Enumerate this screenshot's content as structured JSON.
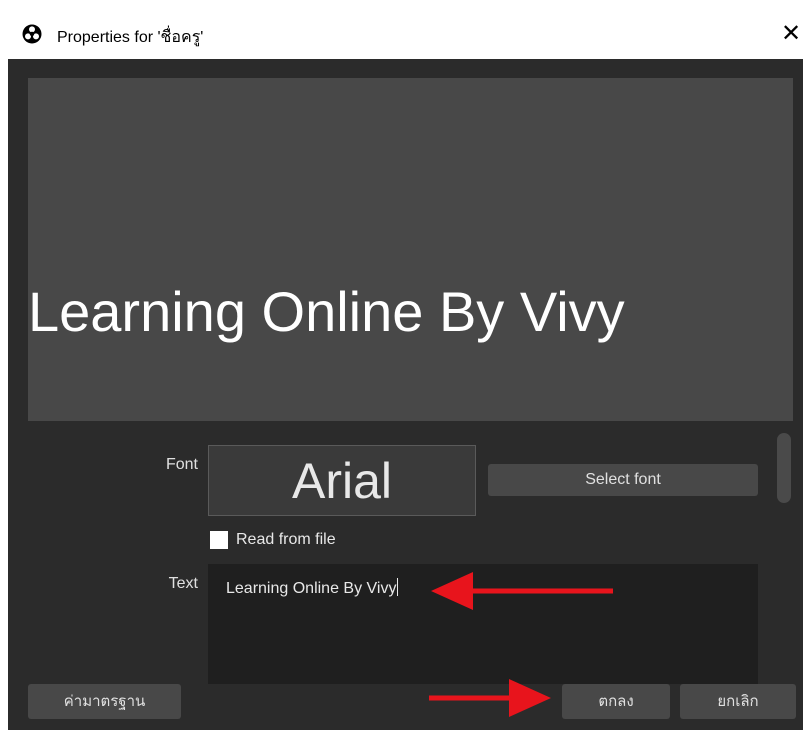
{
  "window": {
    "title": "Properties for 'ชื่อครู'",
    "icon": "obs-logo-icon",
    "close_glyph": "✕"
  },
  "preview": {
    "text": "Learning Online By Vivy"
  },
  "form": {
    "font_label": "Font",
    "font_name": "Arial",
    "select_font_label": "Select font",
    "read_from_file_label": "Read from file",
    "read_from_file_checked": false,
    "text_label": "Text",
    "text_value": "Learning Online By Vivy"
  },
  "buttons": {
    "defaults": "ค่ามาตรฐาน",
    "ok": "ตกลง",
    "cancel": "ยกเลิก"
  },
  "annotations": {
    "arrow_color": "#e8141c"
  }
}
